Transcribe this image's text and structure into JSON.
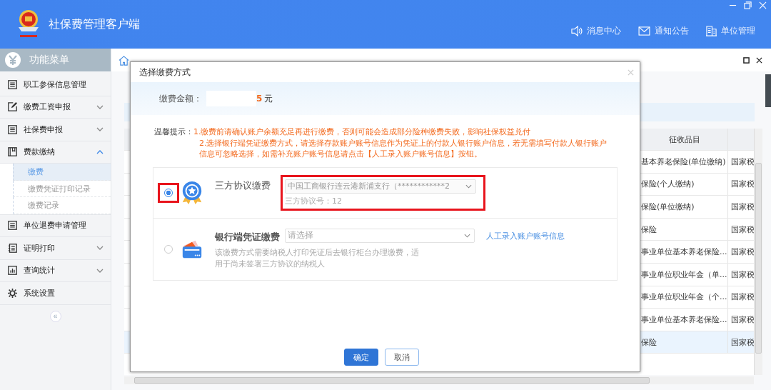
{
  "app": {
    "title": "社保费管理客户端"
  },
  "nav": [
    {
      "kind": "speaker",
      "label": "消息中心"
    },
    {
      "kind": "mail",
      "label": "通知公告"
    },
    {
      "kind": "building",
      "label": "单位管理"
    }
  ],
  "sidebar": {
    "title": "功能菜单",
    "items": [
      {
        "kind": "list",
        "label": "职工参保信息管理"
      },
      {
        "kind": "edit",
        "label": "缴费工资申报",
        "expanded": false
      },
      {
        "kind": "doc",
        "label": "社保费申报",
        "expanded": false
      },
      {
        "kind": "book",
        "label": "费款缴纳",
        "expanded": true,
        "children": [
          {
            "label": "缴费",
            "selected": true
          },
          {
            "label": "缴费凭证打印记录",
            "selected": false
          },
          {
            "label": "缴费记录",
            "selected": false
          }
        ]
      },
      {
        "kind": "list",
        "label": "单位退费申请管理"
      },
      {
        "kind": "print",
        "label": "证明打印",
        "expanded": false
      },
      {
        "kind": "chart",
        "label": "查询统计",
        "expanded": false
      },
      {
        "kind": "gear",
        "label": "系统设置"
      }
    ],
    "collapse": "«"
  },
  "table": {
    "columns": [
      {
        "label": "征收品目"
      }
    ],
    "rows": [
      {
        "item": "基本养老保险(单位缴纳)",
        "column_3": "国家税",
        "selected": false
      },
      {
        "item": "保险(个人缴纳)",
        "column_3": "国家税",
        "selected": false
      },
      {
        "item": "保险(单位缴纳)",
        "column_3": "国家税",
        "selected": false
      },
      {
        "item": "保险",
        "column_3": "国家税",
        "selected": false
      },
      {
        "item": "事业单位基本养老保险...",
        "column_3": "国家税",
        "selected": false
      },
      {
        "item": "事业单位职业年金（单...",
        "column_3": "国家税",
        "selected": false
      },
      {
        "item": "事业单位职业年金（个...",
        "column_3": "国家税",
        "selected": false
      },
      {
        "item": "事业单位基本养老保险...",
        "column_3": "国家税",
        "selected": false
      },
      {
        "item": "保险",
        "column_3": "国家税",
        "selected": true
      }
    ]
  },
  "dialog": {
    "title": "选择缴费方式",
    "amount_label": "缴费金额：",
    "amount": "5",
    "currency": "元",
    "tip_label": "温馨提示：",
    "tips": [
      "1.缴费前请确认账户余额充足再进行缴费，否则可能会造成部分险种缴费失败，影响社保权益兑付",
      "2.选择银行端凭证缴费方式，请选择存款账户账号信息作为凭证上的付款人银行账户信息，若无需填写付款人银行账户信息可忽略选择，如需补充账户账号信息请点击【人工录入账户账号信息】按钮。"
    ],
    "options": [
      {
        "kind": "agreement",
        "title": "三方协议缴费",
        "selected": true,
        "highlighted": true,
        "value": "中国工商银行连云港新浦支行（************2",
        "note": "三方协议号：12"
      },
      {
        "kind": "bank",
        "title": "银行端凭证缴费",
        "selected": false,
        "highlighted": false,
        "placeholder": "请选择",
        "link": "人工录入账户账号信息",
        "description": "该缴费方式需要纳税人打印凭证后去银行柜台办理缴费，适用于尚未签署三方协议的纳税人"
      }
    ],
    "buttons": [
      {
        "kind": "primary",
        "label": "确定"
      },
      {
        "kind": "plain",
        "label": "取消"
      }
    ]
  }
}
